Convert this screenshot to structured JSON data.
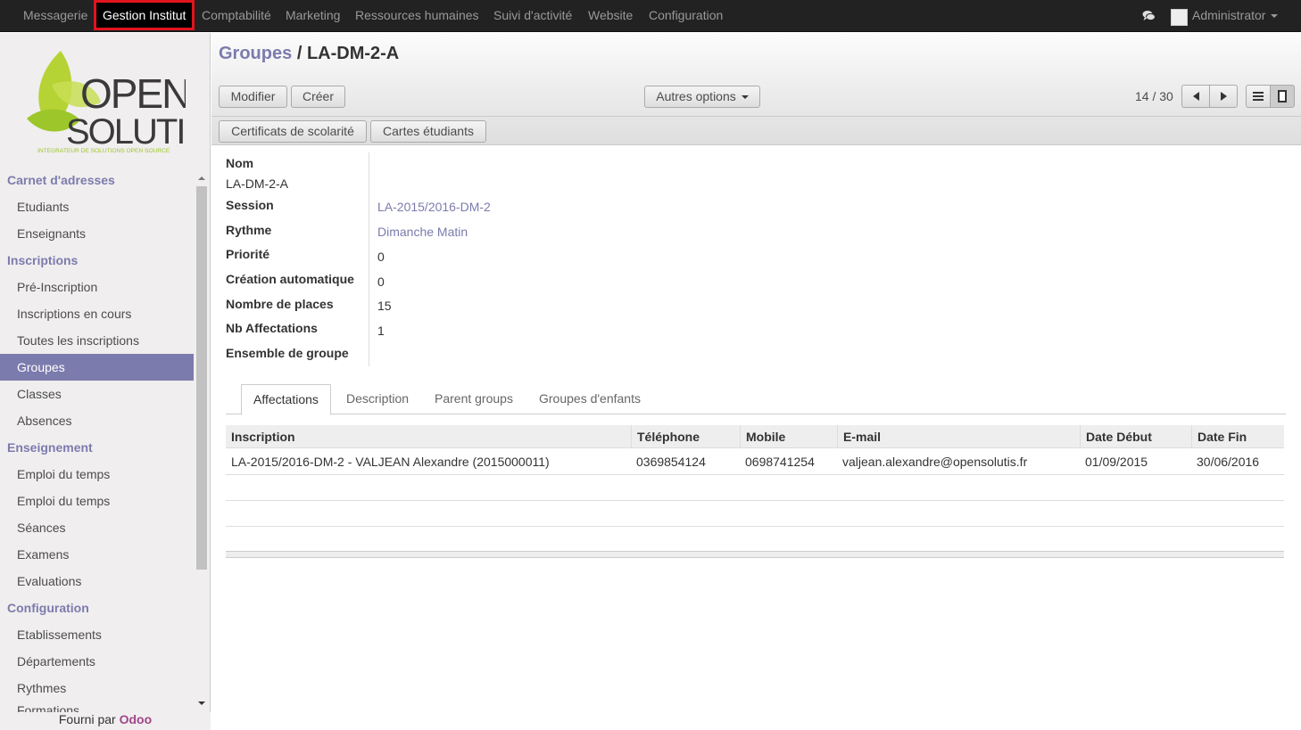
{
  "navbar": {
    "items": [
      "Messagerie",
      "Gestion Institut",
      "Comptabilité",
      "Marketing",
      "Ressources humaines",
      "Suivi d'activité",
      "Website",
      "Configuration"
    ],
    "active": "Gestion Institut",
    "user": "Administrator"
  },
  "sidebar": {
    "logo_text_1": "OPEN",
    "logo_text_2": "SOLUTIS",
    "logo_tagline": "INTEGRATEUR DE SOLUTIONS OPEN SOURCE",
    "sections": [
      {
        "title": "Carnet d'adresses",
        "items": [
          "Etudiants",
          "Enseignants"
        ]
      },
      {
        "title": "Inscriptions",
        "items": [
          "Pré-Inscription",
          "Inscriptions en cours",
          "Toutes les inscriptions",
          "Groupes",
          "Classes",
          "Absences"
        ]
      },
      {
        "title": "Enseignement",
        "items": [
          "Emploi du temps",
          "Emploi du temps",
          "Séances",
          "Examens",
          "Evaluations"
        ]
      },
      {
        "title": "Configuration",
        "items": [
          "Etablissements",
          "Départements",
          "Rythmes"
        ]
      }
    ],
    "cut_item": "Formations",
    "active_item": "Groupes",
    "footer_prefix": "Fourni par",
    "footer_brand": "Odoo"
  },
  "header": {
    "breadcrumb_parent": "Groupes",
    "breadcrumb_sep": "/",
    "breadcrumb_current": "LA-DM-2-A",
    "edit_label": "Modifier",
    "create_label": "Créer",
    "more_label": "Autres options",
    "pager": "14 / 30",
    "certif_label": "Certificats de scolarité",
    "cards_label": "Cartes étudiants"
  },
  "form": {
    "nom_label": "Nom",
    "nom_value": "LA-DM-2-A",
    "fields": [
      {
        "label": "Session",
        "value": "LA-2015/2016-DM-2",
        "link": true
      },
      {
        "label": "Rythme",
        "value": "Dimanche Matin",
        "link": true
      },
      {
        "label": "Priorité",
        "value": "0",
        "link": false
      },
      {
        "label": "Création automatique",
        "value": "0",
        "link": false
      },
      {
        "label": "Nombre de places",
        "value": "15",
        "link": false
      },
      {
        "label": "Nb Affectations",
        "value": "1",
        "link": false
      },
      {
        "label": "Ensemble de groupe",
        "value": "",
        "link": false
      }
    ]
  },
  "tabs": [
    "Affectations",
    "Description",
    "Parent groups",
    "Groupes d'enfants"
  ],
  "active_tab": "Affectations",
  "table": {
    "columns": [
      "Inscription",
      "Téléphone",
      "Mobile",
      "E-mail",
      "Date Début",
      "Date Fin"
    ],
    "rows": [
      [
        "LA-2015/2016-DM-2 - VALJEAN Alexandre (2015000011)",
        "0369854124",
        "0698741254",
        "valjean.alexandre@opensolutis.fr",
        "01/09/2015",
        "30/06/2016"
      ]
    ]
  },
  "colors": {
    "accent": "#7c7bad",
    "navbar_bg": "#222222",
    "highlight_border": "#e0141e",
    "brand_odoo": "#a24689",
    "logo_green": "#9cc62a"
  }
}
